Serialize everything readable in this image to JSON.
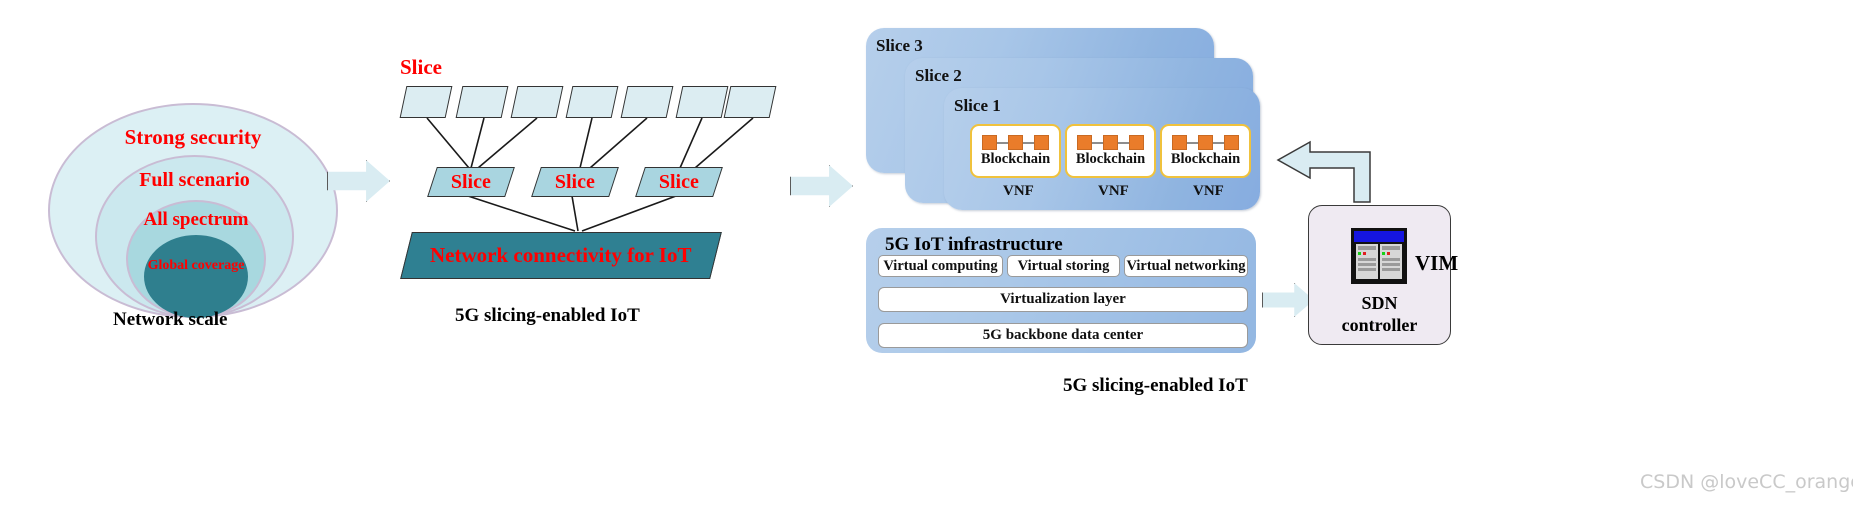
{
  "panel_network_scale": {
    "caption": "Network scale",
    "rings": [
      {
        "label": "Strong security",
        "color": "#dcf0f4",
        "font_size": 21
      },
      {
        "label": "Full scenario",
        "color": "#cbe8ee",
        "font_size": 20
      },
      {
        "label": "All spectrum",
        "color": "#a8d8df",
        "font_size": 19
      },
      {
        "label": "Global coverage",
        "color": "#2f7f8e",
        "font_size": 14
      }
    ]
  },
  "panel_slicing": {
    "caption": "5G slicing-enabled IoT",
    "top_label": "Slice",
    "slice_boxes": [
      "Slice",
      "Slice",
      "Slice"
    ],
    "base_label": "Network connectivity for IoT",
    "small_tile_count": 7
  },
  "panel_infrastructure": {
    "caption": "5G slicing-enabled IoT",
    "slice_cards": [
      {
        "label": "Slice 3"
      },
      {
        "label": "Slice 2"
      },
      {
        "label": "Slice 1"
      }
    ],
    "vnfs": [
      {
        "blockchain_label": "Blockchain",
        "vnf_label": "VNF",
        "node_count": 3
      },
      {
        "blockchain_label": "Blockchain",
        "vnf_label": "VNF",
        "node_count": 3
      },
      {
        "blockchain_label": "Blockchain",
        "vnf_label": "VNF",
        "node_count": 3
      }
    ],
    "infra_title": "5G IoT infrastructure",
    "infra_chips": [
      "Virtual computing",
      "Virtual storing",
      "Virtual networking"
    ],
    "infra_bars": [
      "Virtualization layer",
      "5G backbone data center"
    ]
  },
  "panel_controller": {
    "vim_label": "VIM",
    "sdn_line1": "SDN",
    "sdn_line2": "controller",
    "icon": "server-rack-icon"
  },
  "watermark": "CSDN @loveCC_orange",
  "colors": {
    "red_text": "#ff0000",
    "teal_dark": "#2f7f8e",
    "ring_border": "#c9bcd4",
    "card_blue": "#a8c6e8",
    "blockchain_orange": "#ea7c2a",
    "blockchain_border": "#f0c23c",
    "arrow_fill": "#d9ecf2",
    "vim_fill": "#efeaf2"
  }
}
